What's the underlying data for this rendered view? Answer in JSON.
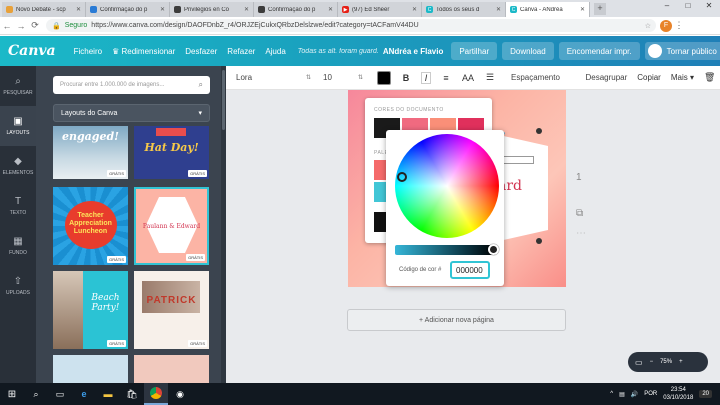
{
  "browser": {
    "tabs": [
      {
        "label": "Novo Debate - scp",
        "favicon_color": "#e8a13a"
      },
      {
        "label": "Confirmação do p",
        "favicon_color": "#2a7bd5"
      },
      {
        "label": "Privilegios en Co",
        "favicon_color": "#3c3c3c"
      },
      {
        "label": "Confirmação do p",
        "favicon_color": "#3c3c3c"
      },
      {
        "label": "(97) Ed Sheer",
        "favicon_color": "#e62117"
      },
      {
        "label": "Todos os seus d",
        "favicon_color": "#1bb9c8"
      },
      {
        "label": "Canva - ANdréa",
        "favicon_color": "#1bb9c8"
      }
    ],
    "active_tab_index": 6,
    "url": "https://www.canva.com/design/DAOFDnbZ_r4/ORJZEjCukxQRbzDelslzwe/edit?category=tACFamV44DU",
    "secure_label": "Seguro",
    "profile_initial": "F"
  },
  "topbar": {
    "logo": "Canva",
    "menu": [
      "Ficheiro",
      "Redimensionar",
      "Desfazer",
      "Refazer",
      "Ajuda"
    ],
    "saved_status": "Todas as alt. foram guard.",
    "doc_name": "ANdréa e Flavio",
    "share_label": "Partilhar",
    "download_label": "Download",
    "order_label": "Encomendar impr.",
    "publish_label": "Tornar público"
  },
  "rail": [
    {
      "label": "PESQUISAR",
      "icon": "search-icon",
      "glyph": "⌕"
    },
    {
      "label": "LAYOUTS",
      "icon": "layout-icon",
      "glyph": "▣"
    },
    {
      "label": "ELEMENTOS",
      "icon": "shapes-icon",
      "glyph": "◆"
    },
    {
      "label": "TEXTO",
      "icon": "text-icon",
      "glyph": "T"
    },
    {
      "label": "FUNDO",
      "icon": "background-icon",
      "glyph": "▦"
    },
    {
      "label": "UPLOADS",
      "icon": "upload-icon",
      "glyph": "⇧"
    }
  ],
  "panel": {
    "search_placeholder": "Procurar entre 1.000.000 de imagens...",
    "layout_select": "Layouts do Canva",
    "badge": "GRÁTIS",
    "thumbs": [
      {
        "title": "engaged!",
        "subtitle": ""
      },
      {
        "title": "Hat Day!",
        "subtitle": ""
      },
      {
        "title": "Teacher Appreciation Luncheon",
        "subtitle": ""
      },
      {
        "title": "Paulann & Edward",
        "subtitle": ""
      },
      {
        "title": "Beach Party!",
        "subtitle": ""
      },
      {
        "title": "PATRICK",
        "subtitle": ""
      }
    ]
  },
  "editor_toolbar": {
    "font": "Lora",
    "size": "10",
    "color": "#000000",
    "spacing_label": "Espaçamento",
    "ungroup_label": "Desagrupar",
    "copy_label": "Copiar",
    "more_label": "Mais"
  },
  "canvas": {
    "page_text": "ard",
    "page_question": "?",
    "add_page_label": "+ Adicionar nova página",
    "zoom": "75%"
  },
  "color_popover": {
    "doc_colors_label": "CORES DO DOCUMENTO",
    "palette_label": "PALETA",
    "doc_colors": [
      "#1a1a1a",
      "#f06a80",
      "#fa8f78",
      "#e0305c",
      "#222222"
    ],
    "palette_colors": [
      "#f56a6a",
      "#41c6d6",
      "#111111"
    ]
  },
  "color_picker": {
    "hex_label": "Código de cor #",
    "hex_value": "000000"
  },
  "taskbar": {
    "lang": "POR",
    "time": "23:54",
    "date": "03/10/2018",
    "notifications": "20"
  }
}
